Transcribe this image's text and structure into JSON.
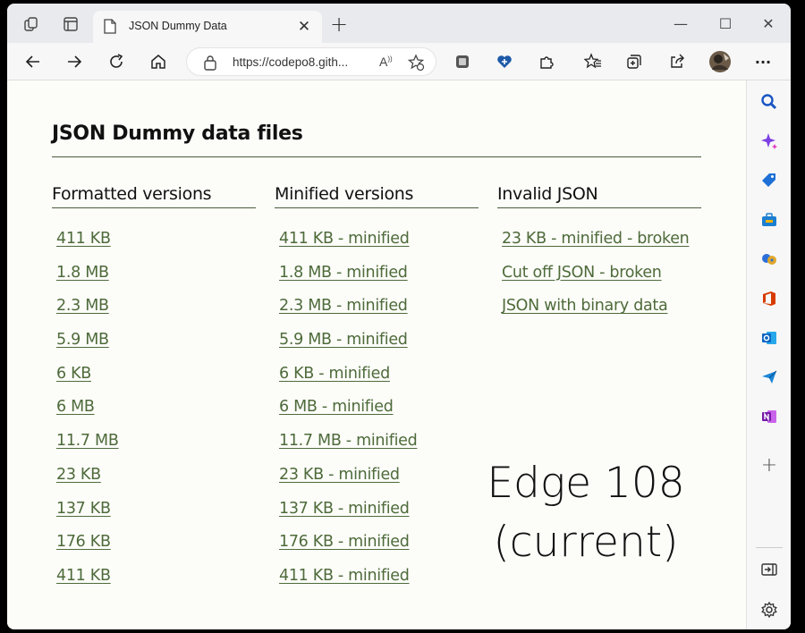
{
  "browser": {
    "tab_title": "JSON Dummy Data",
    "tab_close": "✕",
    "new_tab": "+",
    "url": "https://codepo8.gith...",
    "window_controls": {
      "minimize": "—",
      "maximize": "☐",
      "close": "✕"
    },
    "menu": "···"
  },
  "page": {
    "title": "JSON Dummy data files",
    "columns": [
      {
        "heading": "Formatted versions",
        "links": [
          "411 KB",
          "1.8 MB",
          "2.3 MB",
          "5.9 MB",
          "6 KB",
          "6 MB",
          "11.7 MB",
          "23 KB",
          "137 KB",
          "176 KB",
          "411 KB"
        ]
      },
      {
        "heading": "Minified versions",
        "links": [
          "411 KB - minified",
          "1.8 MB - minified",
          "2.3 MB - minified",
          "5.9 MB - minified",
          "6 KB - minified",
          "6 MB - minified",
          "11.7 MB - minified",
          "23 KB - minified",
          "137 KB - minified",
          "176 KB - minified",
          "411 KB - minified"
        ]
      },
      {
        "heading": "Invalid JSON",
        "links": [
          "23 KB - minified - broken",
          "Cut off JSON - broken",
          "JSON with binary data"
        ]
      }
    ]
  },
  "overlay": {
    "line1": "Edge 108",
    "line2": "(current)"
  },
  "colors": {
    "link": "#4e6b3a",
    "rule": "#4a5e3a",
    "page_bg": "#fcfcf9"
  },
  "icons": {
    "titlebar": [
      "workspaces-icon",
      "vertical-tabs-icon"
    ],
    "toolbar": [
      "back-icon",
      "forward-icon",
      "refresh-icon",
      "home-icon",
      "lock-icon",
      "read-aloud-icon",
      "add-favorite-icon",
      "extension-1-icon",
      "browser-essentials-icon",
      "extensions-icon",
      "favorites-icon",
      "collections-icon",
      "share-icon",
      "profile-avatar",
      "more-icon"
    ],
    "sidebar": [
      "search-icon",
      "discover-icon",
      "shopping-icon",
      "tools-icon",
      "games-icon",
      "office-icon",
      "outlook-icon",
      "drop-icon",
      "onenote-icon",
      "add-icon",
      "hide-sidebar-icon",
      "settings-icon"
    ]
  }
}
